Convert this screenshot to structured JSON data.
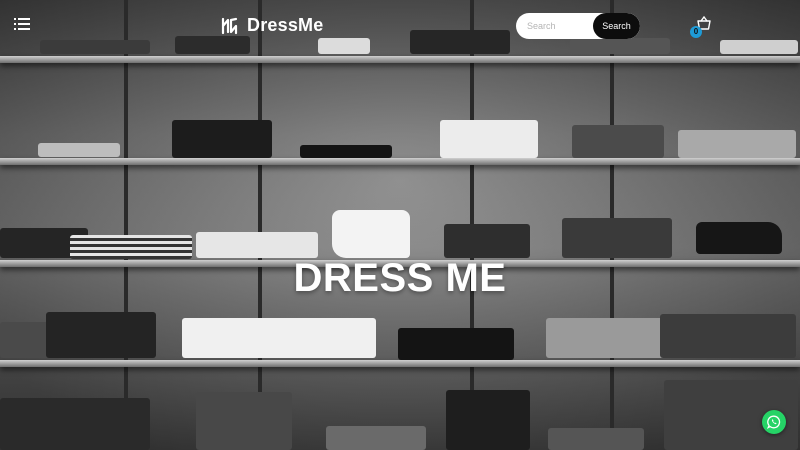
{
  "header": {
    "menu_icon": "hamburger-menu-icon",
    "brand_name": "DressMe",
    "logo_icon": "dressme-logo-icon",
    "search": {
      "placeholder": "Search",
      "button_label": "Search"
    },
    "cart": {
      "icon": "shopping-basket-icon",
      "count": "0"
    }
  },
  "hero": {
    "title": "DRESS ME"
  },
  "floating": {
    "whatsapp_icon": "whatsapp-icon"
  },
  "colors": {
    "accent": "#1e9bd7",
    "search_button": "#0d0d0d",
    "whatsapp": "#25d366",
    "text": "#ffffff"
  }
}
